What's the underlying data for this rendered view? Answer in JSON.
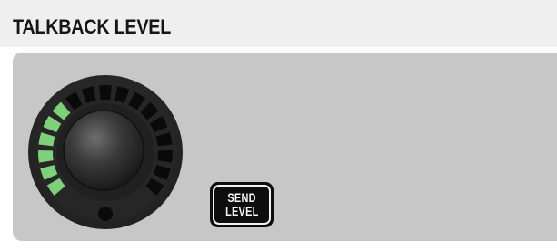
{
  "header": {
    "title": "TALKBACK LEVEL"
  },
  "talkback_knob": {
    "level_lit_segments": 6,
    "total_segments": 17,
    "lit_color": "#7fd07a",
    "unlit_color": "#0a0a0a",
    "ring_color": "#2a2a2a"
  },
  "send_level_button": {
    "line1": "SEND",
    "line2": "LEVEL"
  },
  "colors": {
    "header_bg": "#efefef",
    "panel_bg": "#c7c7c7",
    "text": "#161616"
  }
}
